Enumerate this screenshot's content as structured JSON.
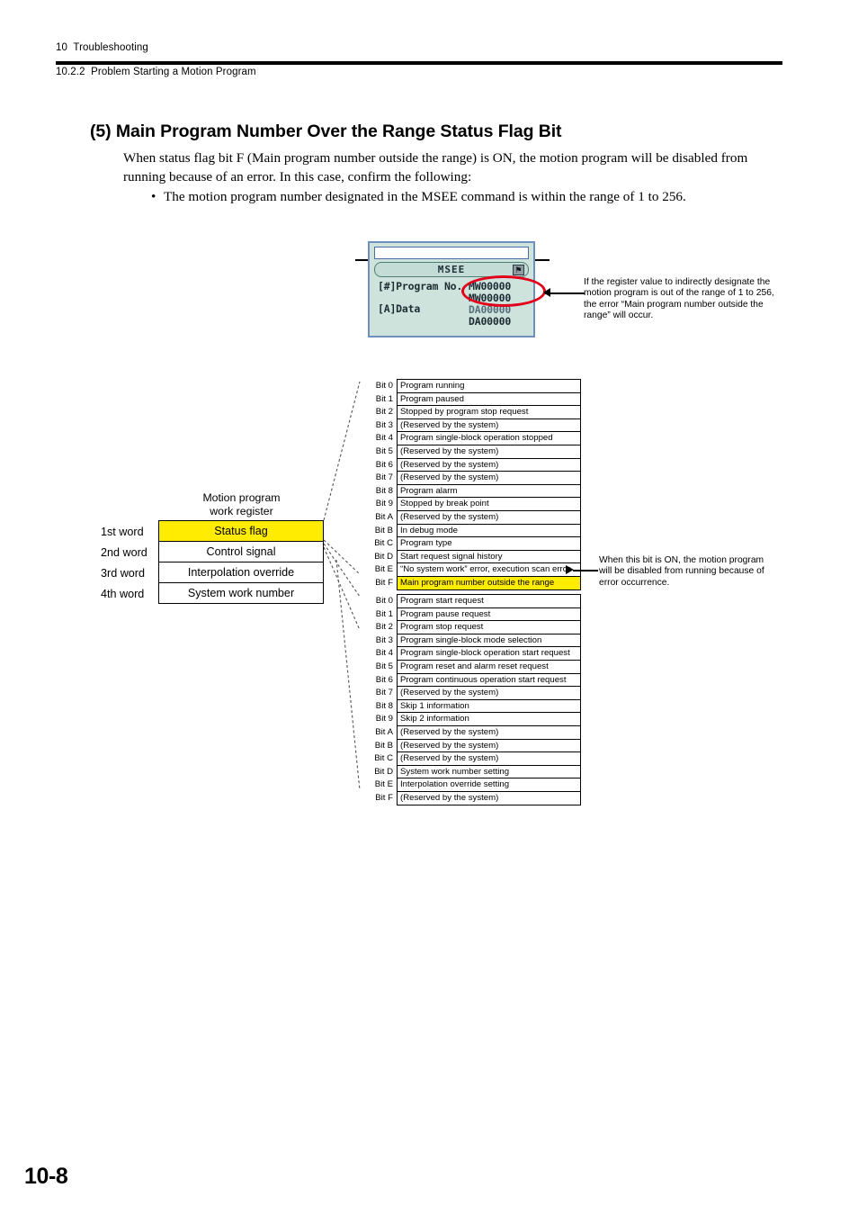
{
  "header": {
    "chapter": "10  Troubleshooting",
    "section": "10.2.2  Problem Starting a Motion Program"
  },
  "heading": "(5) Main Program Number Over the Range Status Flag Bit",
  "intro_paragraph": "When status flag bit F (Main program number outside the range) is ON, the motion program will be disabled from running because of an error. In this case, confirm the following:",
  "bullet": {
    "mark": "•",
    "text": "The motion program number designated in the MSEE command is within the range of 1 to 256."
  },
  "lcd_dialog": {
    "title": "MSEE",
    "title_icon": "⚑",
    "label_program_no": "[#]Program No.",
    "label_data": "[A]Data",
    "value_1": "MW00000",
    "value_2": "MW00000",
    "value_3": "DA00000",
    "value_4": "DA00000"
  },
  "callouts": {
    "register_range": "If the register value to indirectly designate the motion program is out of the range of 1 to 256, the error “Main program number outside the range” will occur.",
    "bit_on": "When this bit is ON, the motion program will be disabled from running because of error occurrence."
  },
  "word_register": {
    "title_line_1": "Motion program",
    "title_line_2": "work register",
    "rows": [
      {
        "word": "1st word",
        "name": "Status flag",
        "highlighted": true
      },
      {
        "word": "2nd word",
        "name": "Control signal",
        "highlighted": false
      },
      {
        "word": "3rd word",
        "name": "Interpolation override",
        "highlighted": false
      },
      {
        "word": "4th word",
        "name": "System work number",
        "highlighted": false
      }
    ]
  },
  "status_flag_bits": [
    {
      "bit": "Bit 0",
      "desc": "Program running",
      "highlighted": false
    },
    {
      "bit": "Bit 1",
      "desc": "Program paused",
      "highlighted": false
    },
    {
      "bit": "Bit 2",
      "desc": "Stopped by program stop request",
      "highlighted": false
    },
    {
      "bit": "Bit 3",
      "desc": "(Reserved by the system)",
      "highlighted": false
    },
    {
      "bit": "Bit 4",
      "desc": "Program single-block operation stopped",
      "highlighted": false
    },
    {
      "bit": "Bit 5",
      "desc": "(Reserved by the system)",
      "highlighted": false
    },
    {
      "bit": "Bit 6",
      "desc": "(Reserved by the system)",
      "highlighted": false
    },
    {
      "bit": "Bit 7",
      "desc": "(Reserved by the system)",
      "highlighted": false
    },
    {
      "bit": "Bit 8",
      "desc": "Program alarm",
      "highlighted": false
    },
    {
      "bit": "Bit 9",
      "desc": "Stopped by break point",
      "highlighted": false
    },
    {
      "bit": "Bit A",
      "desc": "(Reserved by the system)",
      "highlighted": false
    },
    {
      "bit": "Bit B",
      "desc": "In debug mode",
      "highlighted": false
    },
    {
      "bit": "Bit C",
      "desc": "Program type",
      "highlighted": false
    },
    {
      "bit": "Bit D",
      "desc": "Start request signal history",
      "highlighted": false
    },
    {
      "bit": "Bit E",
      "desc": "“No system work” error, execution scan error",
      "highlighted": false
    },
    {
      "bit": "Bit F",
      "desc": "Main program number outside the range",
      "highlighted": true
    }
  ],
  "control_signal_bits": [
    {
      "bit": "Bit 0",
      "desc": "Program start request",
      "highlighted": false
    },
    {
      "bit": "Bit 1",
      "desc": "Program pause request",
      "highlighted": false
    },
    {
      "bit": "Bit 2",
      "desc": "Program stop request",
      "highlighted": false
    },
    {
      "bit": "Bit 3",
      "desc": "Program single-block mode selection",
      "highlighted": false
    },
    {
      "bit": "Bit 4",
      "desc": "Program single-block operation start request",
      "highlighted": false
    },
    {
      "bit": "Bit 5",
      "desc": "Program reset and alarm reset request",
      "highlighted": false
    },
    {
      "bit": "Bit 6",
      "desc": "Program continuous operation start request",
      "highlighted": false
    },
    {
      "bit": "Bit 7",
      "desc": "(Reserved by the system)",
      "highlighted": false
    },
    {
      "bit": "Bit 8",
      "desc": "Skip 1 information",
      "highlighted": false
    },
    {
      "bit": "Bit 9",
      "desc": "Skip 2 information",
      "highlighted": false
    },
    {
      "bit": "Bit A",
      "desc": "(Reserved by the system)",
      "highlighted": false
    },
    {
      "bit": "Bit B",
      "desc": "(Reserved by the system)",
      "highlighted": false
    },
    {
      "bit": "Bit C",
      "desc": "(Reserved by the system)",
      "highlighted": false
    },
    {
      "bit": "Bit D",
      "desc": "System work number setting",
      "highlighted": false
    },
    {
      "bit": "Bit E",
      "desc": "Interpolation override setting",
      "highlighted": false
    },
    {
      "bit": "Bit F",
      "desc": "(Reserved by the system)",
      "highlighted": false
    }
  ],
  "page_number": "10-8"
}
